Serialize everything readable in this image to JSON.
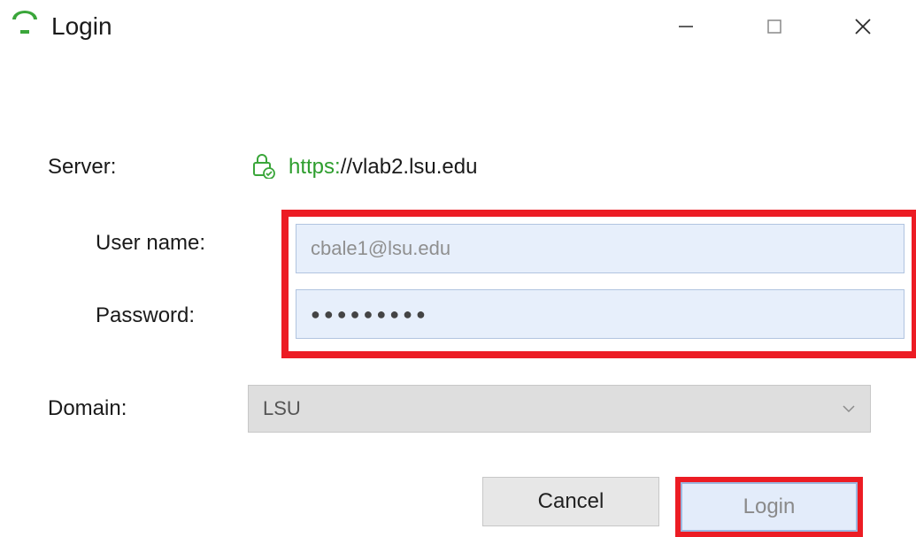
{
  "window": {
    "title": "Login"
  },
  "form": {
    "server_label": "Server:",
    "server_url_prefix": "https:",
    "server_url_rest": "//vlab2.lsu.edu",
    "username_label": "User name:",
    "username_placeholder": "cbale1@lsu.edu",
    "username_value": "",
    "password_label": "Password:",
    "password_value": "●●●●●●●●●",
    "domain_label": "Domain:",
    "domain_selected": "LSU"
  },
  "buttons": {
    "cancel": "Cancel",
    "login": "Login"
  }
}
